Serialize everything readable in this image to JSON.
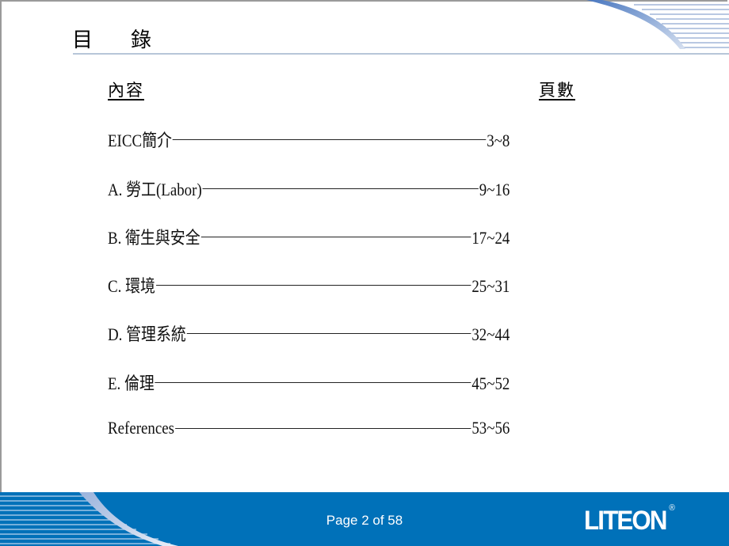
{
  "slide": {
    "title_chars": [
      "目",
      "錄"
    ],
    "header": {
      "content_label": "內容",
      "pages_label": "頁數"
    },
    "toc": [
      {
        "label": "EICC簡介",
        "pages": "3~8"
      },
      {
        "label": "A.  勞工(Labor)",
        "pages": "9~16"
      },
      {
        "label": "B.  衛生與安全",
        "pages": "17~24"
      },
      {
        "label": "C.  環境",
        "pages": "25~31"
      },
      {
        "label": "D.  管理系統",
        "pages": "32~44"
      },
      {
        "label": "E.  倫理",
        "pages": "45~52"
      },
      {
        "label": "References",
        "pages": "53~56"
      }
    ]
  },
  "footer": {
    "page_text": "Page 2 of 58",
    "logo_text": "LITEON",
    "logo_mark": "®",
    "band_color": "#0071b9"
  }
}
